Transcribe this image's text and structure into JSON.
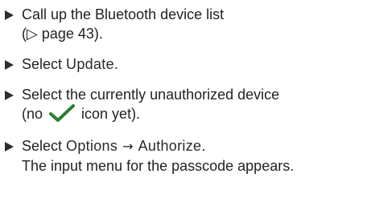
{
  "steps": [
    {
      "line1": "Call up the Bluetooth device list",
      "line2": "(▷ page 43)."
    },
    {
      "prefix": "Select ",
      "ui": "Update",
      "suffix": "."
    },
    {
      "line1": "Select the currently unauthorized device",
      "line2_before": "(no ",
      "icon": "checkmark-icon",
      "line2_after": " icon yet)."
    },
    {
      "prefix": "Select ",
      "ui1": "Options",
      "arrow": "→",
      "ui2": "Authorize",
      "suffix": ".",
      "result": "The input menu for the passcode appears."
    }
  ],
  "colors": {
    "text": "#222222",
    "bullet": "#2d2d2d",
    "check": "#2e7d32"
  }
}
